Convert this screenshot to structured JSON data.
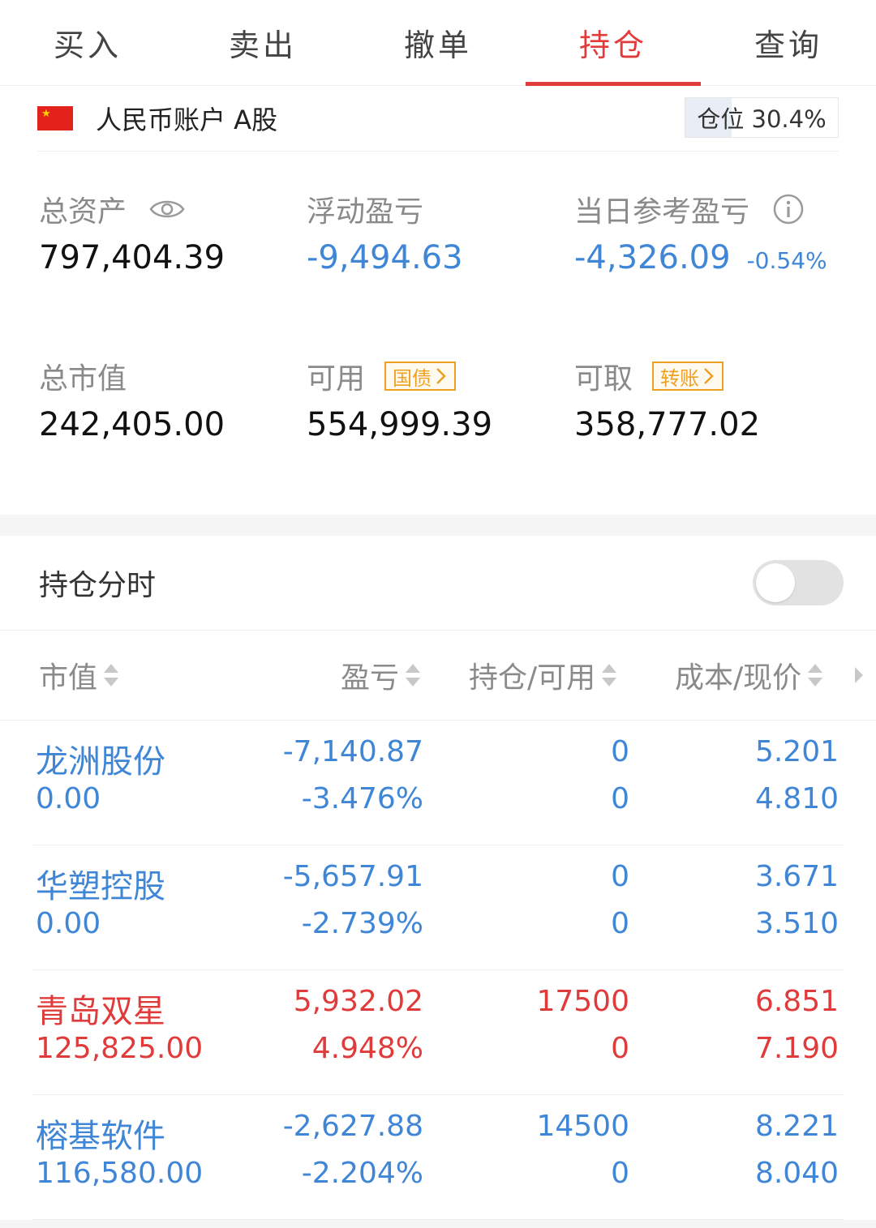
{
  "tabs": [
    {
      "label": "买入",
      "active": false
    },
    {
      "label": "卖出",
      "active": false
    },
    {
      "label": "撤单",
      "active": false
    },
    {
      "label": "持仓",
      "active": true
    },
    {
      "label": "查询",
      "active": false
    }
  ],
  "account": {
    "flag_icon": "china-flag-icon",
    "name": "人民币账户 A股",
    "position_ratio_text": "仓位 30.4%",
    "position_ratio": 30.4
  },
  "summary": {
    "total_assets_label": "总资产",
    "total_assets_value": "797,404.39",
    "floating_pnl_label": "浮动盈亏",
    "floating_pnl_value": "-9,494.63",
    "daily_pnl_label": "当日参考盈亏",
    "daily_pnl_value": "-4,326.09",
    "daily_pnl_percent": "-0.54%",
    "market_value_label": "总市值",
    "market_value_value": "242,405.00",
    "available_label": "可用",
    "available_tag": "国债",
    "available_value": "554,999.39",
    "withdrawable_label": "可取",
    "withdrawable_tag": "转账",
    "withdrawable_value": "358,777.02"
  },
  "holding_time": {
    "title": "持仓分时",
    "toggle_on": false
  },
  "table": {
    "headers": [
      "市值",
      "盈亏",
      "持仓/可用",
      "成本/现价"
    ],
    "rows": [
      {
        "name": "龙洲股份",
        "market_value": "0.00",
        "pnl": "-7,140.87",
        "pnl_pct": "-3.476%",
        "position": "0",
        "available": "0",
        "cost": "5.201",
        "price": "4.810",
        "color": "blue"
      },
      {
        "name": "华塑控股",
        "market_value": "0.00",
        "pnl": "-5,657.91",
        "pnl_pct": "-2.739%",
        "position": "0",
        "available": "0",
        "cost": "3.671",
        "price": "3.510",
        "color": "blue"
      },
      {
        "name": "青岛双星",
        "market_value": "125,825.00",
        "pnl": "5,932.02",
        "pnl_pct": "4.948%",
        "position": "17500",
        "available": "0",
        "cost": "6.851",
        "price": "7.190",
        "color": "red"
      },
      {
        "name": "榕基软件",
        "market_value": "116,580.00",
        "pnl": "-2,627.88",
        "pnl_pct": "-2.204%",
        "position": "14500",
        "available": "0",
        "cost": "8.221",
        "price": "8.040",
        "color": "blue"
      }
    ]
  },
  "colors": {
    "accent_red": "#e23b3b",
    "loss_blue": "#3f86d6",
    "gain_red": "#e03b3b",
    "tag_orange": "#f0a020",
    "label_gray": "#8a8a8a"
  }
}
